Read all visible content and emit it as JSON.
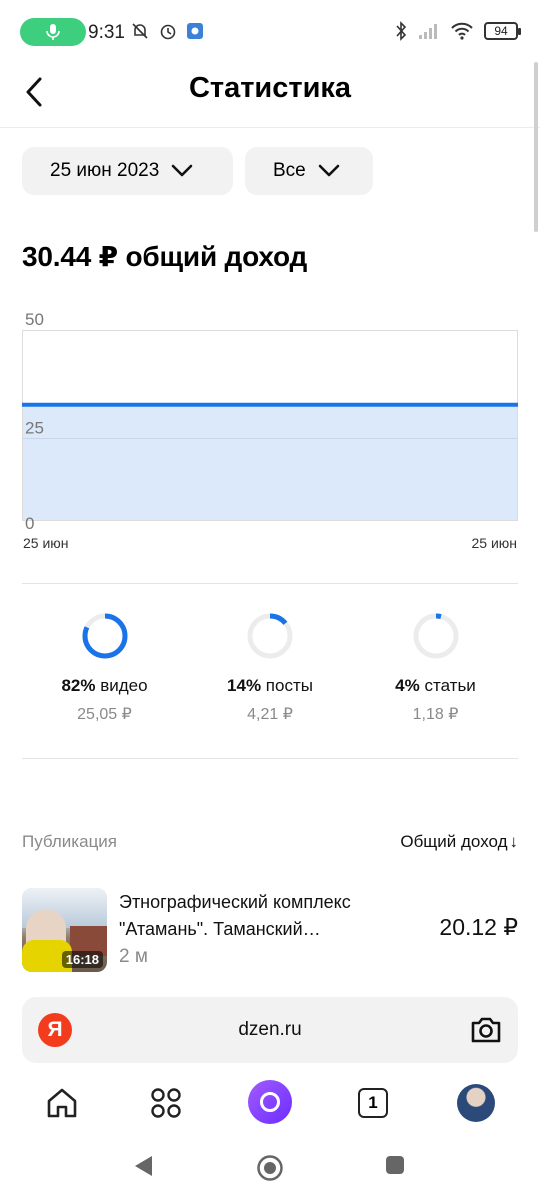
{
  "status": {
    "time": "9:31",
    "battery": "94"
  },
  "header": {
    "title": "Статистика"
  },
  "filters": {
    "date": "25 июн 2023",
    "type": "Все"
  },
  "summary": {
    "total": "30.44 ₽ общий доход"
  },
  "chart_data": {
    "type": "area",
    "x": [
      "25 июн",
      "25 июн"
    ],
    "values": [
      30.44,
      30.44
    ],
    "yticks": [
      "50",
      "25",
      "0"
    ],
    "ylim": [
      0,
      50
    ],
    "grid": true,
    "color": "#1a73e8",
    "fill": "#dce9fb"
  },
  "breakdown": [
    {
      "pct": "82%",
      "label": "видео",
      "value": "25,05 ₽",
      "fraction": 0.82
    },
    {
      "pct": "14%",
      "label": "посты",
      "value": "4,21 ₽",
      "fraction": 0.14
    },
    {
      "pct": "4%",
      "label": "статьи",
      "value": "1,18 ₽",
      "fraction": 0.04
    }
  ],
  "list": {
    "col_left": "Публикация",
    "col_right": "Общий доход",
    "sort_arrow": "↓",
    "rows": [
      {
        "title_line1": "Этнографический комплекс",
        "title_line2": "\"Атамань\". Таманский…",
        "duration": "16:18",
        "age": "2 м",
        "income": "20.12 ₽"
      }
    ]
  },
  "browser": {
    "logo": "Я",
    "url": "dzen.ru",
    "tabs_count": "1"
  },
  "colors": {
    "accent": "#1a73e8",
    "ring_track": "#ececec"
  }
}
